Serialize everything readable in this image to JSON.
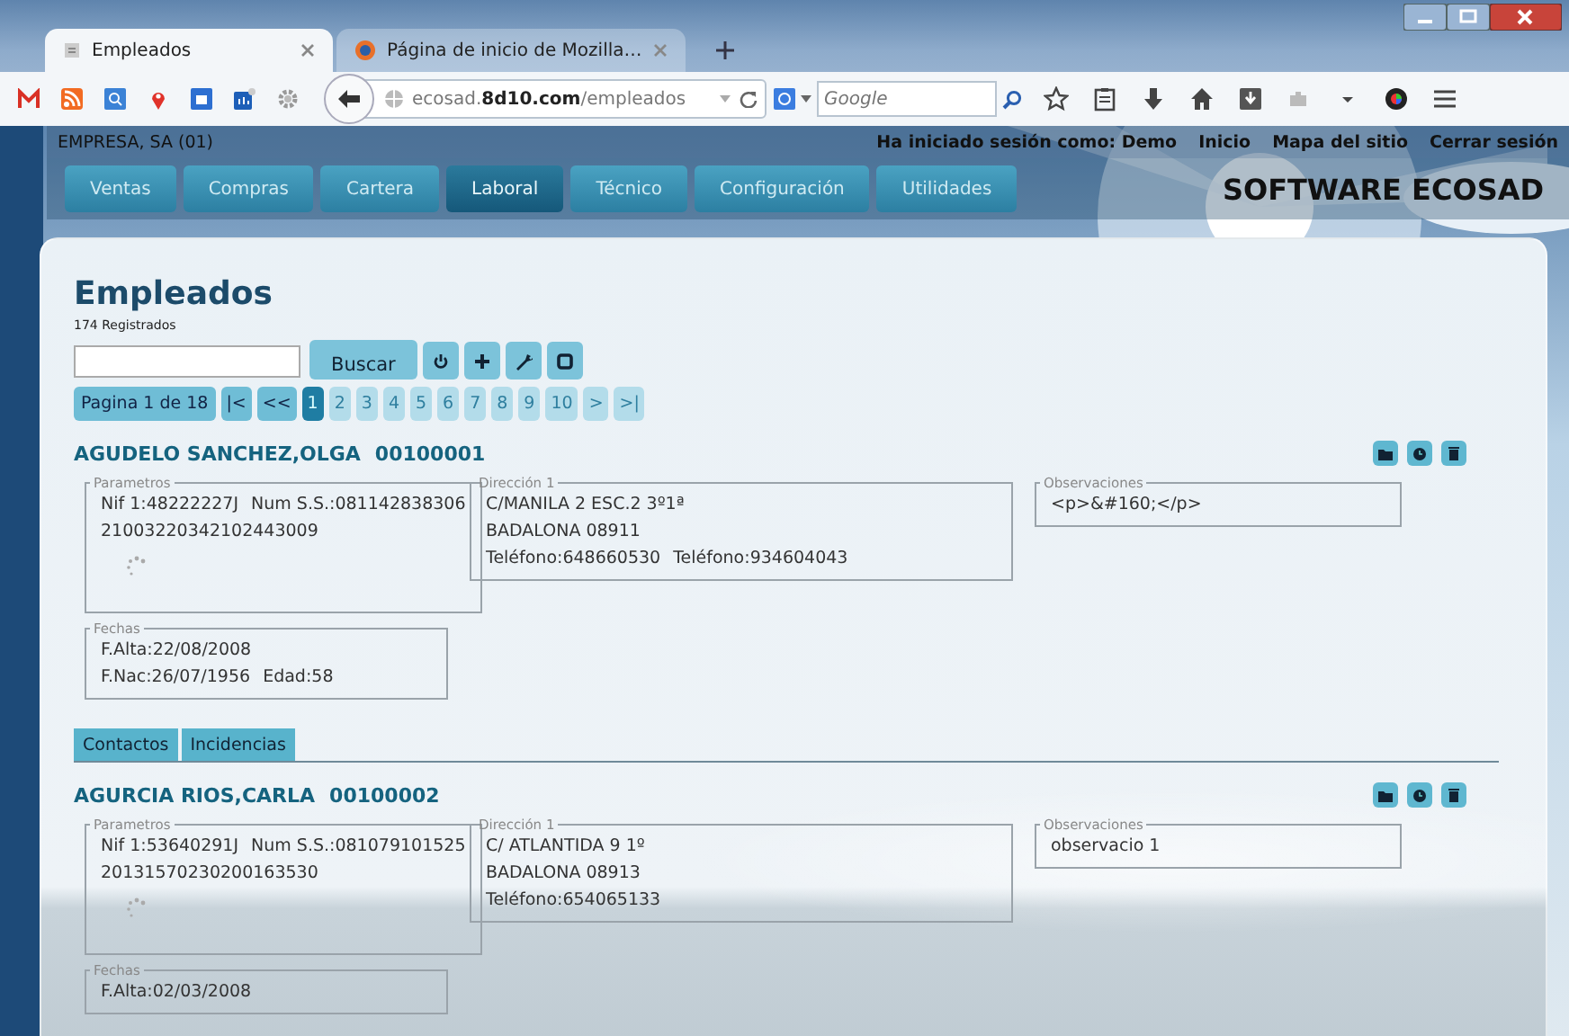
{
  "browser": {
    "tabs": [
      {
        "title": "Empleados",
        "selected": true
      },
      {
        "title": "Página de inicio de Mozilla…",
        "selected": false
      }
    ],
    "url": "ecosad.**8d10.com**/empleados",
    "search": {
      "placeholder": "Google"
    }
  },
  "app": {
    "company": "EMPRESA, SA (01)",
    "session": "Ha iniciado sesión como: Demo",
    "links": [
      "Inicio",
      "Mapa del sitio",
      "Cerrar sesión"
    ],
    "nav": [
      {
        "label": "Ventas",
        "selected": false
      },
      {
        "label": "Compras",
        "selected": false
      },
      {
        "label": "Cartera",
        "selected": false
      },
      {
        "label": "Laboral",
        "selected": true
      },
      {
        "label": "Técnico",
        "selected": false
      },
      {
        "label": "Configuración",
        "selected": false
      },
      {
        "label": "Utilidades",
        "selected": false
      }
    ],
    "brand": "SOFTWARE ECOSAD"
  },
  "page": {
    "title": "Empleados",
    "count": "174 Registrados",
    "search_button": "Buscar",
    "pager_label": "Pagina 1 de 18",
    "pager": [
      {
        "label": "|<",
        "selected": false,
        "disabled": false
      },
      {
        "label": "<<",
        "selected": false,
        "disabled": false
      },
      {
        "label": "1",
        "selected": true,
        "disabled": false
      },
      {
        "label": "2",
        "selected": false,
        "disabled": true
      },
      {
        "label": "3",
        "selected": false,
        "disabled": true
      },
      {
        "label": "4",
        "selected": false,
        "disabled": true
      },
      {
        "label": "5",
        "selected": false,
        "disabled": true
      },
      {
        "label": "6",
        "selected": false,
        "disabled": true
      },
      {
        "label": "7",
        "selected": false,
        "disabled": true
      },
      {
        "label": "8",
        "selected": false,
        "disabled": true
      },
      {
        "label": "9",
        "selected": false,
        "disabled": true
      },
      {
        "label": "10",
        "selected": false,
        "disabled": true
      },
      {
        "label": ">",
        "selected": false,
        "disabled": true
      },
      {
        "label": ">|",
        "selected": false,
        "disabled": true
      }
    ]
  },
  "employees": [
    {
      "name": "AGUDELO SANCHEZ,OLGA",
      "code": "00100001",
      "parameters": {
        "legend": "Parametros",
        "lines": [
          [
            "Nif 1:48222227J",
            "Num S.S.:081142838306"
          ],
          [
            "21003220342102443009"
          ]
        ]
      },
      "address": {
        "legend": "Dirección 1",
        "lines": [
          [
            "C/MANILA 2 ESC.2 3º1ª"
          ],
          [
            "BADALONA 08911"
          ],
          [
            "Teléfono:648660530",
            "Teléfono:934604043"
          ]
        ]
      },
      "notes": {
        "legend": "Observaciones",
        "lines": [
          [
            "<p>&#160;</p>"
          ]
        ]
      },
      "dates": {
        "legend": "Fechas",
        "lines": [
          [
            "F.Alta:22/08/2008"
          ],
          [
            "F.Nac:26/07/1956",
            "Edad:58"
          ]
        ]
      },
      "tabs": [
        "Contactos",
        "Incidencias"
      ]
    },
    {
      "name": "AGURCIA RIOS,CARLA",
      "code": "00100002",
      "parameters": {
        "legend": "Parametros",
        "lines": [
          [
            "Nif 1:53640291J",
            "Num S.S.:081079101525"
          ],
          [
            "20131570230200163530"
          ]
        ]
      },
      "address": {
        "legend": "Dirección 1",
        "lines": [
          [
            "C/ ATLANTIDA 9 1º"
          ],
          [
            "BADALONA 08913"
          ],
          [
            "Teléfono:654065133"
          ]
        ]
      },
      "notes": {
        "legend": "Observaciones",
        "lines": [
          [
            "observacio 1"
          ]
        ]
      },
      "dates": {
        "legend": "Fechas",
        "lines": [
          [
            "F.Alta:02/03/2008"
          ]
        ]
      }
    }
  ]
}
